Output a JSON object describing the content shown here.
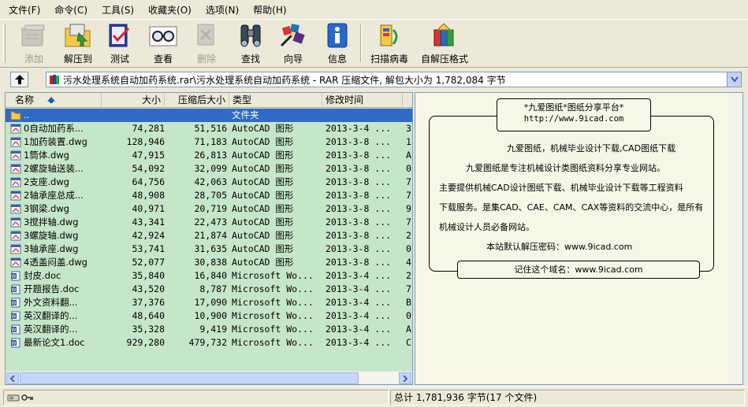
{
  "menu": [
    "文件(F)",
    "命令(C)",
    "工具(S)",
    "收藏夹(O)",
    "选项(N)",
    "帮助(H)"
  ],
  "toolbar": {
    "add": "添加",
    "extract": "解压到",
    "test": "测试",
    "view": "查看",
    "delete": "删除",
    "find": "查找",
    "wizard": "向导",
    "info": "信息",
    "scan": "扫描病毒",
    "sfx": "自解压格式"
  },
  "address": {
    "path": "污水处理系统自动加药系统.rar\\污水处理系统自动加药系统 - RAR 压缩文件, 解包大小为 1,782,084 字节"
  },
  "columns": {
    "name": "名称",
    "size": "大小",
    "packed": "压缩后大小",
    "type": "类型",
    "modified": "修改时间"
  },
  "files": [
    {
      "name": "..",
      "size": "",
      "packed": "",
      "type": "文件夹",
      "modified": "",
      "extra": "",
      "icon": "folder"
    },
    {
      "name": "0自动加药系...",
      "size": "74,281",
      "packed": "51,516",
      "type": "AutoCAD 图形",
      "modified": "2013-3-4 ...",
      "extra": "3",
      "icon": "dwg"
    },
    {
      "name": "1加药装置.dwg",
      "size": "128,946",
      "packed": "71,183",
      "type": "AutoCAD 图形",
      "modified": "2013-3-8 ...",
      "extra": "1",
      "icon": "dwg"
    },
    {
      "name": "1筒体.dwg",
      "size": "47,915",
      "packed": "26,813",
      "type": "AutoCAD 图形",
      "modified": "2013-3-8 ...",
      "extra": "A",
      "icon": "dwg"
    },
    {
      "name": "2螺旋轴送装...",
      "size": "54,092",
      "packed": "32,099",
      "type": "AutoCAD 图形",
      "modified": "2013-3-8 ...",
      "extra": "0",
      "icon": "dwg"
    },
    {
      "name": "2支座.dwg",
      "size": "64,756",
      "packed": "42,063",
      "type": "AutoCAD 图形",
      "modified": "2013-3-8 ...",
      "extra": "7",
      "icon": "dwg"
    },
    {
      "name": "2轴承座总成...",
      "size": "48,908",
      "packed": "28,705",
      "type": "AutoCAD 图形",
      "modified": "2013-3-8 ...",
      "extra": "7",
      "icon": "dwg"
    },
    {
      "name": "3钢梁.dwg",
      "size": "40,971",
      "packed": "20,719",
      "type": "AutoCAD 图形",
      "modified": "2013-3-8 ...",
      "extra": "9",
      "icon": "dwg"
    },
    {
      "name": "3搅拌轴.dwg",
      "size": "43,341",
      "packed": "22,473",
      "type": "AutoCAD 图形",
      "modified": "2013-3-8 ...",
      "extra": "7",
      "icon": "dwg"
    },
    {
      "name": "3螺旋轴.dwg",
      "size": "42,924",
      "packed": "21,874",
      "type": "AutoCAD 图形",
      "modified": "2013-3-8 ...",
      "extra": "2",
      "icon": "dwg"
    },
    {
      "name": "3轴承座.dwg",
      "size": "53,741",
      "packed": "31,635",
      "type": "AutoCAD 图形",
      "modified": "2013-3-8 ...",
      "extra": "0",
      "icon": "dwg"
    },
    {
      "name": "4透盖闷盖.dwg",
      "size": "52,077",
      "packed": "30,838",
      "type": "AutoCAD 图形",
      "modified": "2013-3-8 ...",
      "extra": "4",
      "icon": "dwg"
    },
    {
      "name": "封皮.doc",
      "size": "35,840",
      "packed": "16,840",
      "type": "Microsoft Wo...",
      "modified": "2013-3-4 ...",
      "extra": "2",
      "icon": "doc"
    },
    {
      "name": "开题报告.doc",
      "size": "43,520",
      "packed": "8,787",
      "type": "Microsoft Wo...",
      "modified": "2013-3-4 ...",
      "extra": "7",
      "icon": "doc"
    },
    {
      "name": "外文资料翻...",
      "size": "37,376",
      "packed": "17,090",
      "type": "Microsoft Wo...",
      "modified": "2013-3-4 ...",
      "extra": "B",
      "icon": "doc"
    },
    {
      "name": "英汉翻译的...",
      "size": "48,640",
      "packed": "10,900",
      "type": "Microsoft Wo...",
      "modified": "2013-3-4 ...",
      "extra": "0",
      "icon": "doc"
    },
    {
      "name": "英汉翻译的...",
      "size": "35,328",
      "packed": "9,419",
      "type": "Microsoft Wo...",
      "modified": "2013-3-4 ...",
      "extra": "A",
      "icon": "doc"
    },
    {
      "name": "最新论文1.doc",
      "size": "929,280",
      "packed": "479,732",
      "type": "Microsoft Wo...",
      "modified": "2013-3-4 ...",
      "extra": "C",
      "icon": "doc"
    }
  ],
  "comment": {
    "title_line1": "*九爱图纸*图纸分享平台*",
    "title_line2": "http://www.9icad.com",
    "line1": "九爱图纸，机械毕业设计下载,CAD图纸下载",
    "line2": "九爱图纸是专注机械设计类图纸资料分享专业网站。",
    "line3": "主要提供机械CAD设计图纸下载、机械毕业设计下载等工程资料",
    "line4": "下载服务。是集CAD、CAE、CAM、CAX等资料的交流中心，是所有",
    "line5": "机械设计人员必备网站。",
    "line6": "本站默认解压密码：www.9icad.com",
    "footer": "记住这个域名：www.9icad.com"
  },
  "status": {
    "total": "总计 1,781,936 字节(17 个文件)"
  },
  "colors": {
    "list_bg": "#c6e6c9",
    "selection": "#316ac5",
    "comment_bg": "#f7f7e7",
    "chrome": "#ece9d8"
  }
}
